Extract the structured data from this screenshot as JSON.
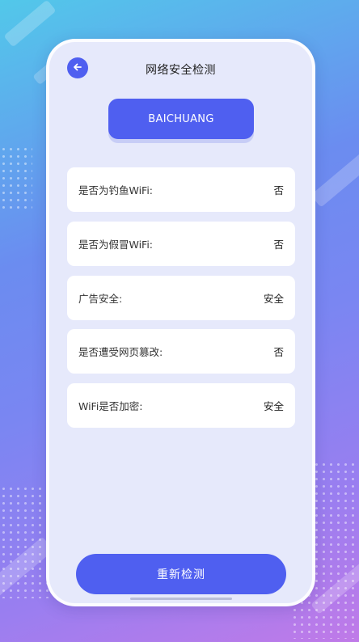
{
  "header": {
    "title": "网络安全检测"
  },
  "brand": {
    "label": "BAICHUANG"
  },
  "checks": [
    {
      "label": "是否为钓鱼WiFi:",
      "value": "否"
    },
    {
      "label": "是否为假冒WiFi:",
      "value": "否"
    },
    {
      "label": "广告安全:",
      "value": "安全"
    },
    {
      "label": "是否遭受网页篡改:",
      "value": "否"
    },
    {
      "label": "WiFi是否加密:",
      "value": "安全"
    }
  ],
  "actions": {
    "recheck_label": "重新检测"
  },
  "icons": {
    "back": "back-arrow-icon"
  },
  "colors": {
    "accent": "#4f5ff0",
    "card": "#e6e9fb"
  }
}
